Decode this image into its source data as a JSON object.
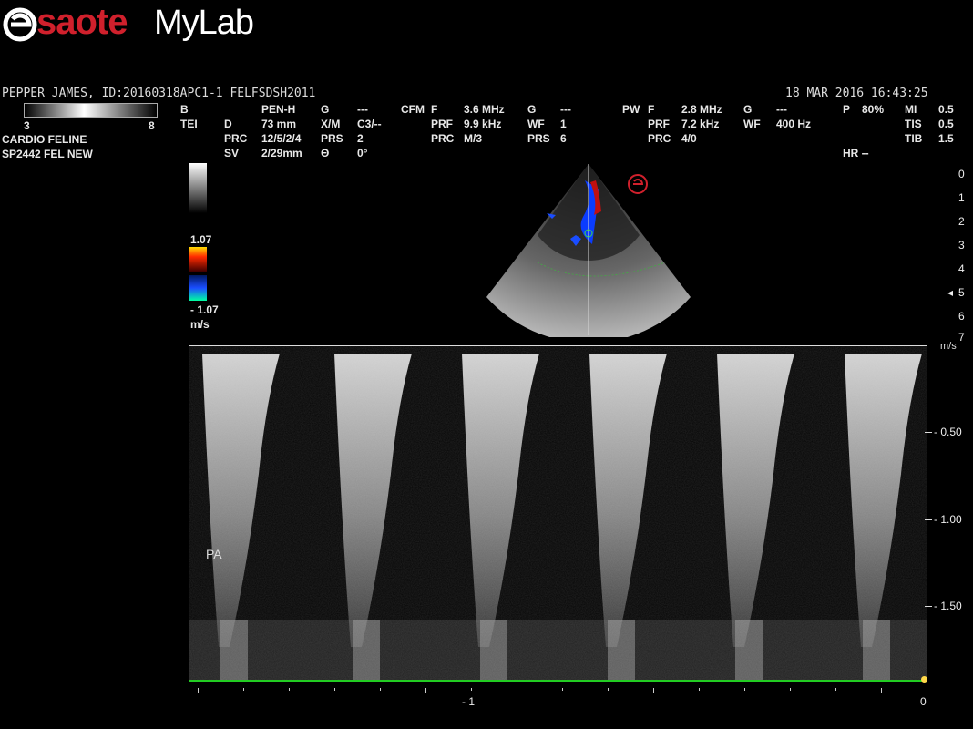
{
  "brand": {
    "name": "saote",
    "suffix": "MyLab"
  },
  "patient": {
    "line": "PEPPER JAMES, ID:20160318APC1-1  FELFSDSH2011",
    "date": "18  MAR  2016 16:43:25"
  },
  "gray_scale": {
    "min": "3",
    "max": "8"
  },
  "preset": {
    "line1": "CARDIO FELINE",
    "line2": "SP2442  FEL NEW"
  },
  "b_mode": {
    "col1": [
      "B",
      "TEI"
    ],
    "col2": [
      "PEN-H",
      "D",
      "PRC",
      "SV"
    ],
    "col3": [
      "73 mm",
      "12/5/2/4",
      "2/29mm"
    ],
    "col4": [
      "G",
      "X/M",
      "PRS",
      "Θ"
    ],
    "col5": [
      "---",
      "C3/--",
      "2",
      "0°"
    ]
  },
  "cfm": {
    "label": "CFM",
    "keys": [
      "F",
      "PRF",
      "PRC"
    ],
    "vals": [
      "3.6 MHz",
      "9.9 kHz",
      "M/3"
    ],
    "keys2": [
      "G",
      "WF",
      "PRS"
    ],
    "vals2": [
      "---",
      "1",
      "6"
    ]
  },
  "pw": {
    "label": "PW",
    "keys": [
      "F",
      "PRF",
      "PRC"
    ],
    "vals": [
      "2.8 MHz",
      "7.2 kHz",
      "4/0"
    ],
    "keys2": [
      "G",
      "WF"
    ],
    "vals2": [
      "---",
      "400 Hz"
    ]
  },
  "power": {
    "label": "P",
    "value": "80%"
  },
  "indices": {
    "keys": [
      "MI",
      "TIS",
      "TIB"
    ],
    "vals": [
      "0.5",
      "0.5",
      "1.5"
    ]
  },
  "hr": "HR --",
  "color_scale": {
    "max": "1.07",
    "min": "- 1.07",
    "unit": "m/s"
  },
  "depth_ticks": [
    "0",
    "1",
    "2",
    "3",
    "4",
    "5",
    "6",
    "7"
  ],
  "doppler": {
    "label": "PA",
    "unit": "m/s",
    "y_ticks": [
      "- 0.50",
      "- 1.00",
      "- 1.50"
    ],
    "x_ticks": [
      "- 1",
      "0"
    ]
  },
  "colors": {
    "brand_red": "#d0202c",
    "baseline": "#22cc22",
    "scale_yellow": "#ffdd00",
    "scale_blue": "#1a4dff"
  }
}
